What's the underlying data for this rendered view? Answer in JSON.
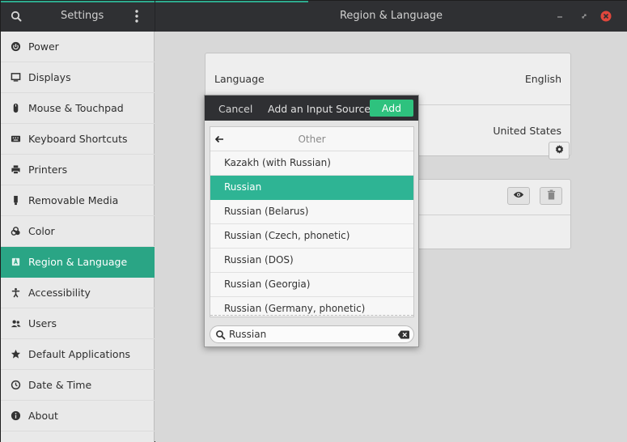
{
  "header": {
    "title": "Settings",
    "page_title": "Region & Language"
  },
  "sidebar": {
    "items": [
      {
        "label": "Power",
        "icon": "power-icon"
      },
      {
        "label": "Displays",
        "icon": "display-icon"
      },
      {
        "label": "Mouse & Touchpad",
        "icon": "mouse-icon"
      },
      {
        "label": "Keyboard Shortcuts",
        "icon": "keyboard-icon"
      },
      {
        "label": "Printers",
        "icon": "printer-icon"
      },
      {
        "label": "Removable Media",
        "icon": "usb-icon"
      },
      {
        "label": "Color",
        "icon": "color-icon"
      },
      {
        "label": "Region & Language",
        "icon": "region-icon",
        "active": true
      },
      {
        "label": "Accessibility",
        "icon": "accessibility-icon"
      },
      {
        "label": "Users",
        "icon": "users-icon"
      },
      {
        "label": "Default Applications",
        "icon": "star-icon"
      },
      {
        "label": "Date & Time",
        "icon": "clock-icon"
      },
      {
        "label": "About",
        "icon": "info-icon"
      }
    ]
  },
  "main": {
    "language_label": "Language",
    "language_value": "English",
    "formats_value": "United States"
  },
  "dialog": {
    "cancel_label": "Cancel",
    "title": "Add an Input Source",
    "add_label": "Add",
    "category": "Other",
    "items": [
      "Kazakh (with Russian)",
      "Russian",
      "Russian (Belarus)",
      "Russian (Czech, phonetic)",
      "Russian (DOS)",
      "Russian (Georgia)",
      "Russian (Germany, phonetic)"
    ],
    "selected_index": 1,
    "search_value": "Russian"
  },
  "colors": {
    "accent": "#2aa585",
    "add_button": "#2ec27e",
    "close_button": "#e0473c",
    "headerbar": "#2f3033"
  }
}
